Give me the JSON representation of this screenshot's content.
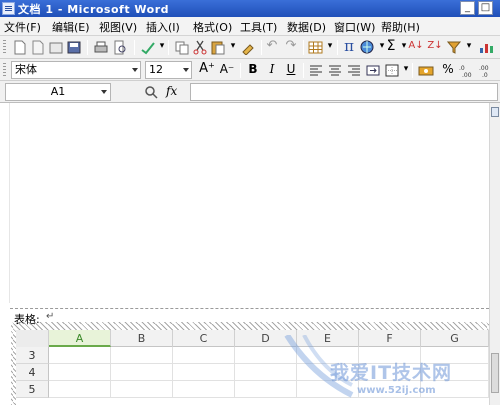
{
  "window": {
    "title": "文档 1 - Microsoft Word",
    "minimize_glyph": "_",
    "maximize_glyph": "□"
  },
  "menu": [
    "文件(F)",
    "编辑(E)",
    "视图(V)",
    "插入(I)",
    "格式(O)",
    "工具(T)",
    "数据(D)",
    "窗口(W)",
    "帮助(H)"
  ],
  "toolbar": {
    "pi_glyph": "π",
    "sigma_glyph": "Σ",
    "dropdown_glyph": "▾",
    "sort_asc_glyph": "A↓",
    "sort_desc_glyph": "Z↓",
    "undo_glyph": "↶",
    "redo_glyph": "↷"
  },
  "format_bar": {
    "font_name": "宋体",
    "font_size": "12",
    "grow_font": "A⁺",
    "shrink_font": "A⁻",
    "bold": "B",
    "italic": "I",
    "underline": "U",
    "percent": "%"
  },
  "formula_bar": {
    "cell_ref": "A1",
    "fx_label": "fx",
    "formula": ""
  },
  "document": {
    "caption": "表格:",
    "return_mark": "↵"
  },
  "sheet": {
    "columns": [
      "A",
      "B",
      "C",
      "D",
      "E",
      "F",
      "G"
    ],
    "selected_column": "A",
    "rows": [
      "3",
      "4",
      "5"
    ]
  },
  "watermark": {
    "text": "我爱IT技术网",
    "url": "www.52ij.com"
  },
  "colors": {
    "titlebar": "#1f4fb8",
    "selected_column": "#3c8a2a"
  }
}
